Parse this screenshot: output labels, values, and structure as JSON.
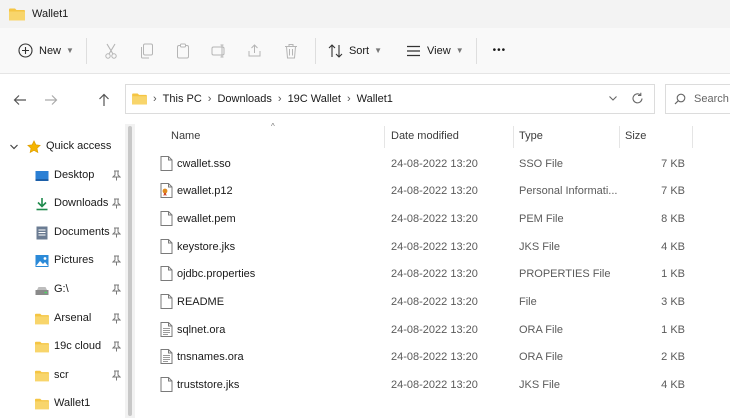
{
  "window": {
    "title": "Wallet1"
  },
  "commandbar": {
    "new_label": "New",
    "sort_label": "Sort",
    "view_label": "View",
    "more_label": "•••"
  },
  "address": {
    "crumbs": [
      "This PC",
      "Downloads",
      "19C Wallet",
      "Wallet1"
    ]
  },
  "search": {
    "placeholder": "Search"
  },
  "sidebar": {
    "quick_access": "Quick access",
    "items": [
      {
        "label": "Desktop",
        "icon": "desktop-icon",
        "pinned": true
      },
      {
        "label": "Downloads",
        "icon": "download-icon",
        "pinned": true
      },
      {
        "label": "Documents",
        "icon": "document-icon",
        "pinned": true
      },
      {
        "label": "Pictures",
        "icon": "pictures-icon",
        "pinned": true
      },
      {
        "label": "G:\\",
        "icon": "drive-icon",
        "pinned": true
      },
      {
        "label": "Arsenal",
        "icon": "folder-icon",
        "pinned": true
      },
      {
        "label": "19c cloud",
        "icon": "folder-icon",
        "pinned": true
      },
      {
        "label": "scr",
        "icon": "folder-icon",
        "pinned": true
      },
      {
        "label": "Wallet1",
        "icon": "folder-icon",
        "pinned": false
      }
    ]
  },
  "columns": {
    "name": "Name",
    "date": "Date modified",
    "type": "Type",
    "size": "Size"
  },
  "files": [
    {
      "name": "cwallet.sso",
      "date": "24-08-2022 13:20",
      "type": "SSO File",
      "size": "7 KB",
      "icon": "file-icon"
    },
    {
      "name": "ewallet.p12",
      "date": "24-08-2022 13:20",
      "type": "Personal Informati...",
      "size": "7 KB",
      "icon": "certificate-icon"
    },
    {
      "name": "ewallet.pem",
      "date": "24-08-2022 13:20",
      "type": "PEM File",
      "size": "8 KB",
      "icon": "file-icon"
    },
    {
      "name": "keystore.jks",
      "date": "24-08-2022 13:20",
      "type": "JKS File",
      "size": "4 KB",
      "icon": "file-icon"
    },
    {
      "name": "ojdbc.properties",
      "date": "24-08-2022 13:20",
      "type": "PROPERTIES File",
      "size": "1 KB",
      "icon": "file-icon"
    },
    {
      "name": "README",
      "date": "24-08-2022 13:20",
      "type": "File",
      "size": "3 KB",
      "icon": "file-icon"
    },
    {
      "name": "sqlnet.ora",
      "date": "24-08-2022 13:20",
      "type": "ORA File",
      "size": "1 KB",
      "icon": "text-file-icon"
    },
    {
      "name": "tnsnames.ora",
      "date": "24-08-2022 13:20",
      "type": "ORA File",
      "size": "2 KB",
      "icon": "text-file-icon"
    },
    {
      "name": "truststore.jks",
      "date": "24-08-2022 13:20",
      "type": "JKS File",
      "size": "4 KB",
      "icon": "file-icon"
    }
  ],
  "colors": {
    "folder": "#f5c543",
    "accent": "#0067c0"
  }
}
